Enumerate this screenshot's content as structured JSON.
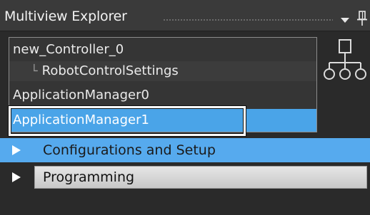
{
  "panel": {
    "title": "Multiview Explorer"
  },
  "selector": {
    "items": [
      {
        "label": "new_Controller_0"
      },
      {
        "label": "RobotControlSettings",
        "tree_prefix": "└"
      },
      {
        "label": "ApplicationManager0"
      },
      {
        "label": "ApplicationManager1",
        "selected": true
      }
    ]
  },
  "categories": [
    {
      "label": "Configurations and Setup"
    },
    {
      "label": "Programming"
    }
  ],
  "colors": {
    "selection": "#4aa4e8",
    "category_active": "#56aaee",
    "highlight_outline": "#ffffff"
  },
  "icons": {
    "dropdown": "dropdown-arrow-icon",
    "pin": "pin-icon",
    "hierarchy": "hierarchy-icon",
    "expand": "expand-arrow-icon"
  }
}
